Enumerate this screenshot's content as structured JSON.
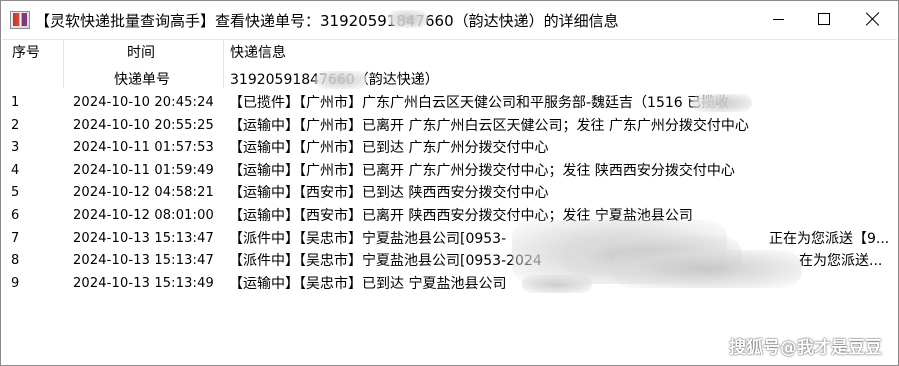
{
  "window": {
    "title": "【灵软快递批量查询高手】查看快递单号：31920591847660（韵达快递）的详细信息",
    "buttons": {
      "minimize": "—",
      "maximize": "☐",
      "close": "✕"
    }
  },
  "table": {
    "headers": {
      "seq": "序号",
      "time": "时间",
      "info": "快递信息"
    },
    "subheader": {
      "time_label": "快递单号",
      "info_value": "31920591847660（韵达快递）"
    },
    "rows": [
      {
        "seq": "1",
        "time": "2024-10-10 20:45:24",
        "info": "【已揽件】【广州市】广东广州白云区天健公司和平服务部-魏廷吉（1516        已揽收"
      },
      {
        "seq": "2",
        "time": "2024-10-10 20:55:25",
        "info": "【运输中】【广州市】已离开 广东广州白云区天健公司；发往 广东广州分拨交付中心"
      },
      {
        "seq": "3",
        "time": "2024-10-11 01:57:53",
        "info": "【运输中】【广州市】已到达 广东广州分拨交付中心"
      },
      {
        "seq": "4",
        "time": "2024-10-11 01:59:49",
        "info": "【运输中】【广州市】已离开 广东广州分拨交付中心；发往 陕西西安分拨交付中心"
      },
      {
        "seq": "5",
        "time": "2024-10-12 04:58:21",
        "info": "【运输中】【西安市】已到达 陕西西安分拨交付中心"
      },
      {
        "seq": "6",
        "time": "2024-10-12 08:01:00",
        "info": "【运输中】【西安市】已离开 陕西西安分拨交付中心；发往 宁夏盐池县公司"
      },
      {
        "seq": "7",
        "time": "2024-10-13 15:13:47",
        "info": "【派件中】【吴忠市】宁夏盐池县公司[0953-",
        "tail": "正在为您派送【9..."
      },
      {
        "seq": "8",
        "time": "2024-10-13 15:13:47",
        "info": "【派件中】【吴忠市】宁夏盐池县公司[0953-2024",
        "tail": "在为您派送..."
      },
      {
        "seq": "9",
        "time": "2024-10-13 15:13:49",
        "info": "【运输中】【吴忠市】已到达 宁夏盐池县公司"
      }
    ]
  },
  "watermark": "搜狐号@我才是豆豆"
}
